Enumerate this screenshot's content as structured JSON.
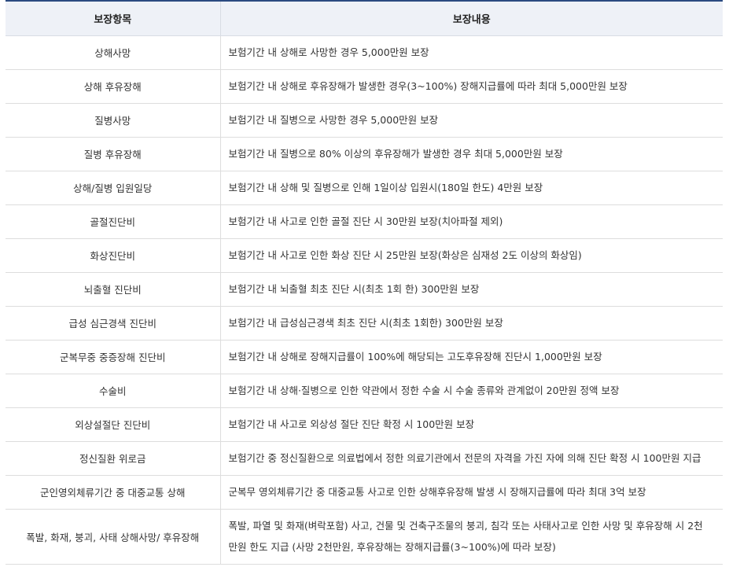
{
  "table": {
    "headers": [
      "보장항목",
      "보장내용"
    ],
    "rows": [
      {
        "item": "상해사망",
        "desc": "보험기간 내 상해로 사망한 경우 5,000만원 보장"
      },
      {
        "item": "상해 후유장해",
        "desc": "보험기간 내 상해로 후유장해가 발생한 경우(3~100%) 장해지급률에 따라 최대 5,000만원 보장"
      },
      {
        "item": "질병사망",
        "desc": "보험기간 내 질병으로 사망한 경우 5,000만원 보장"
      },
      {
        "item": "질병 후유장해",
        "desc": "보험기간 내 질병으로 80% 이상의 후유장해가 발생한 경우 최대 5,000만원 보장"
      },
      {
        "item": "상해/질병 입원일당",
        "desc": "보험기간 내 상해 및 질병으로 인해 1일이상 입원시(180일 한도) 4만원 보장"
      },
      {
        "item": "골절진단비",
        "desc": "보험기간 내 사고로 인한 골절 진단 시 30만원 보장(치아파절 제외)"
      },
      {
        "item": "화상진단비",
        "desc": "보험기간 내 사고로 인한 화상 진단 시 25만원 보장(화상은 심재성 2도 이상의 화상임)"
      },
      {
        "item": "뇌출혈 진단비",
        "desc": "보험기간 내 뇌출혈 최초 진단 시(최초 1회 한) 300만원 보장"
      },
      {
        "item": "급성 심근경색 진단비",
        "desc": "보험기간 내 급성심근경색 최초 진단 시(최초 1회한) 300만원 보장"
      },
      {
        "item": "군복무중 중증장해 진단비",
        "desc": "보험기간 내 상해로 장해지급률이 100%에 해당되는 고도후유장해 진단시 1,000만원 보장"
      },
      {
        "item": "수술비",
        "desc": "보험기간 내 상해·질병으로 인한 약관에서 정한 수술 시 수술 종류와 관계없이 20만원 정액 보장"
      },
      {
        "item": "외상설절단 진단비",
        "desc": "보험기간 내 사고로 외상성 절단 진단 확정 시 100만원 보장"
      },
      {
        "item": "정신질환 위로금",
        "desc": "보험기간 중 정신질환으로 의료법에서 정한 의료기관에서 전문의 자격을 가진 자에 의해 진단 확정 시 100만원 지급"
      },
      {
        "item": "군인영외체류기간 중 대중교통 상해",
        "desc": "군복무 영외체류기간 중 대중교통 사고로 인한 상해후유장해 발생 시 장해지급률에 따라 최대 3억 보장"
      },
      {
        "item": "폭발, 화재, 붕괴, 사태 상해사망/ 후유장해",
        "desc_line1": "폭발, 파열 및 화재(벼락포함) 사고, 건물 및 건축구조물의 붕괴, 침각 또는 사태사고로 인한 사망 및 후유장해 시 2천",
        "desc_line2": "만원 한도 지급 (사망 2천만원, 후유장해는 장해지급률(3~100%)에 따라 보장)"
      }
    ]
  }
}
